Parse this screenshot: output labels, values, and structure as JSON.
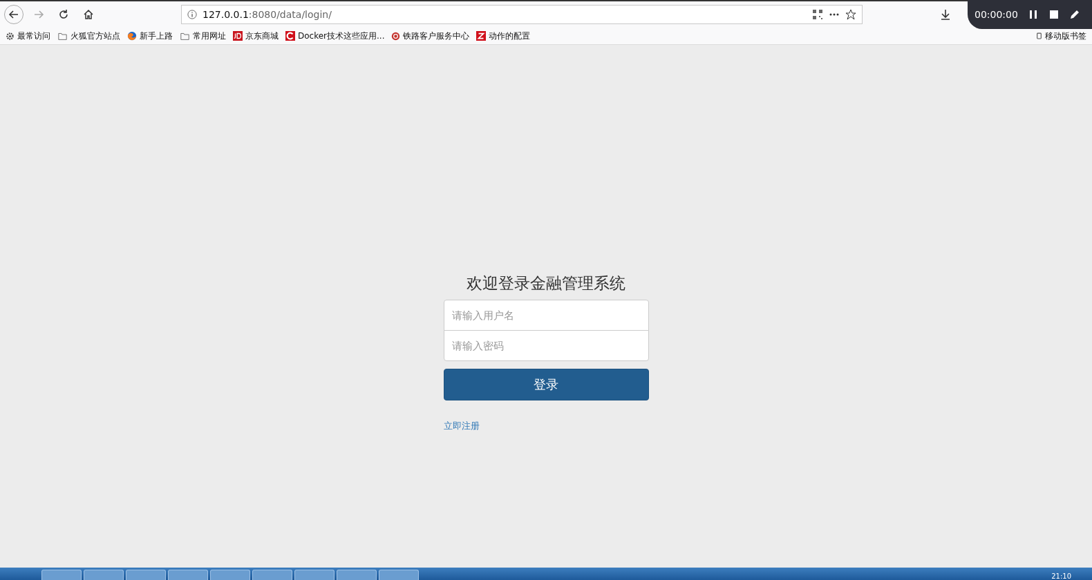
{
  "browser": {
    "url_host": "127.0.0.1",
    "url_path": ":8080/data/login/"
  },
  "bookmarks": [
    {
      "label": "最常访问",
      "kind": "gear"
    },
    {
      "label": "火狐官方站点",
      "kind": "folder"
    },
    {
      "label": "新手上路",
      "kind": "firefox"
    },
    {
      "label": "常用网址",
      "kind": "folder"
    },
    {
      "label": "京东商城",
      "kind": "jd"
    },
    {
      "label": "Docker技术这些应用...",
      "kind": "c"
    },
    {
      "label": "铁路客户服务中心",
      "kind": "rail"
    },
    {
      "label": "动作的配置",
      "kind": "z"
    }
  ],
  "mobile_bookmarks": "移动版书签",
  "recorder": {
    "time": "00:00:00"
  },
  "login": {
    "title": "欢迎登录金融管理系统",
    "username": {
      "placeholder": "请输入用户名"
    },
    "password": {
      "placeholder": "请输入密码"
    },
    "submit": "登录",
    "register_link": "立即注册"
  },
  "taskbar": {
    "clock": "21:10"
  }
}
